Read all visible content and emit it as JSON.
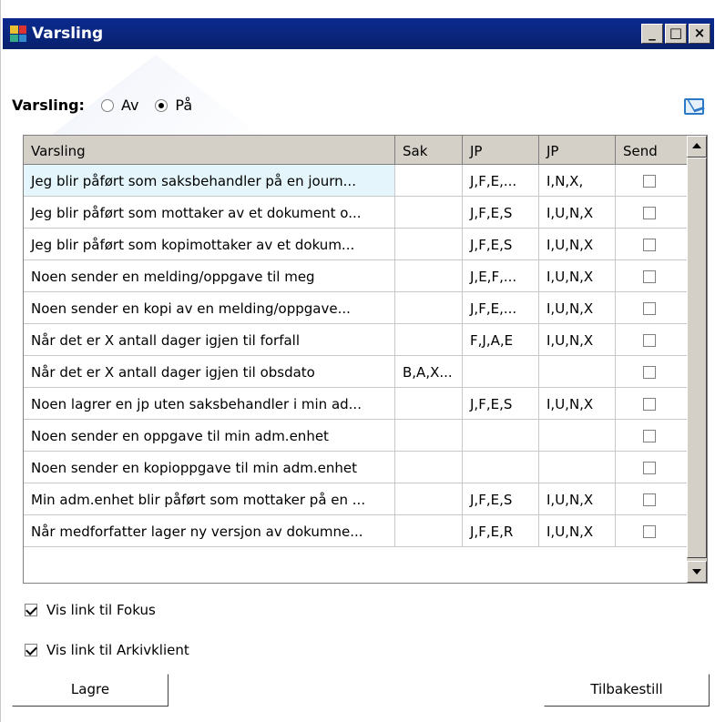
{
  "window": {
    "title": "Varsling",
    "controls": [
      "minimize",
      "maximize",
      "close"
    ]
  },
  "varsling": {
    "label": "Varsling:",
    "options": [
      {
        "label": "Av",
        "selected": false
      },
      {
        "label": "På",
        "selected": true
      }
    ]
  },
  "grid": {
    "columns": [
      "Varsling",
      "Sak",
      "JP",
      "JP",
      "Send"
    ],
    "rows": [
      {
        "varsling": "Jeg blir påført som saksbehandler på en journ...",
        "sak": "",
        "jp1": "J,F,E,...",
        "jp2": "I,N,X,",
        "send": false
      },
      {
        "varsling": "Jeg blir påført som mottaker av et dokument o...",
        "sak": "",
        "jp1": "J,F,E,S",
        "jp2": "I,U,N,X",
        "send": false
      },
      {
        "varsling": "Jeg blir påført som kopimottaker av et dokum...",
        "sak": "",
        "jp1": "J,F,E,S",
        "jp2": "I,U,N,X",
        "send": false
      },
      {
        "varsling": "Noen sender en melding/oppgave til meg",
        "sak": "",
        "jp1": "J,E,F,...",
        "jp2": "I,U,N,X",
        "send": false
      },
      {
        "varsling": "Noen sender en kopi av en melding/oppgave...",
        "sak": "",
        "jp1": "J,F,E,...",
        "jp2": "I,U,N,X",
        "send": false
      },
      {
        "varsling": "Når det er X antall dager igjen til forfall",
        "sak": "",
        "jp1": "F,J,A,E",
        "jp2": "I,U,N,X",
        "send": false
      },
      {
        "varsling": "Når det er X antall dager igjen til obsdato",
        "sak": "B,A,X...",
        "jp1": "",
        "jp2": "",
        "send": false
      },
      {
        "varsling": "Noen lagrer en jp uten saksbehandler i min ad...",
        "sak": "",
        "jp1": "J,F,E,S",
        "jp2": "I,U,N,X",
        "send": false
      },
      {
        "varsling": "Noen sender en oppgave til min adm.enhet",
        "sak": "",
        "jp1": "",
        "jp2": "",
        "send": false
      },
      {
        "varsling": "Noen sender en kopioppgave til min adm.enhet",
        "sak": "",
        "jp1": "",
        "jp2": "",
        "send": false
      },
      {
        "varsling": "Min adm.enhet blir påført som mottaker på en ...",
        "sak": "",
        "jp1": "J,F,E,S",
        "jp2": "I,U,N,X",
        "send": false
      },
      {
        "varsling": "Når medforfatter lager ny versjon av dokumne...",
        "sak": "",
        "jp1": "J,F,E,R",
        "jp2": "I,U,N,X",
        "send": false
      }
    ]
  },
  "options": {
    "fokus": {
      "label": "Vis link til Fokus",
      "checked": true
    },
    "arkiv": {
      "label": "Vis link til Arkivklient",
      "checked": true
    }
  },
  "buttons": {
    "save": "Lagre",
    "reset": "Tilbakestill"
  }
}
